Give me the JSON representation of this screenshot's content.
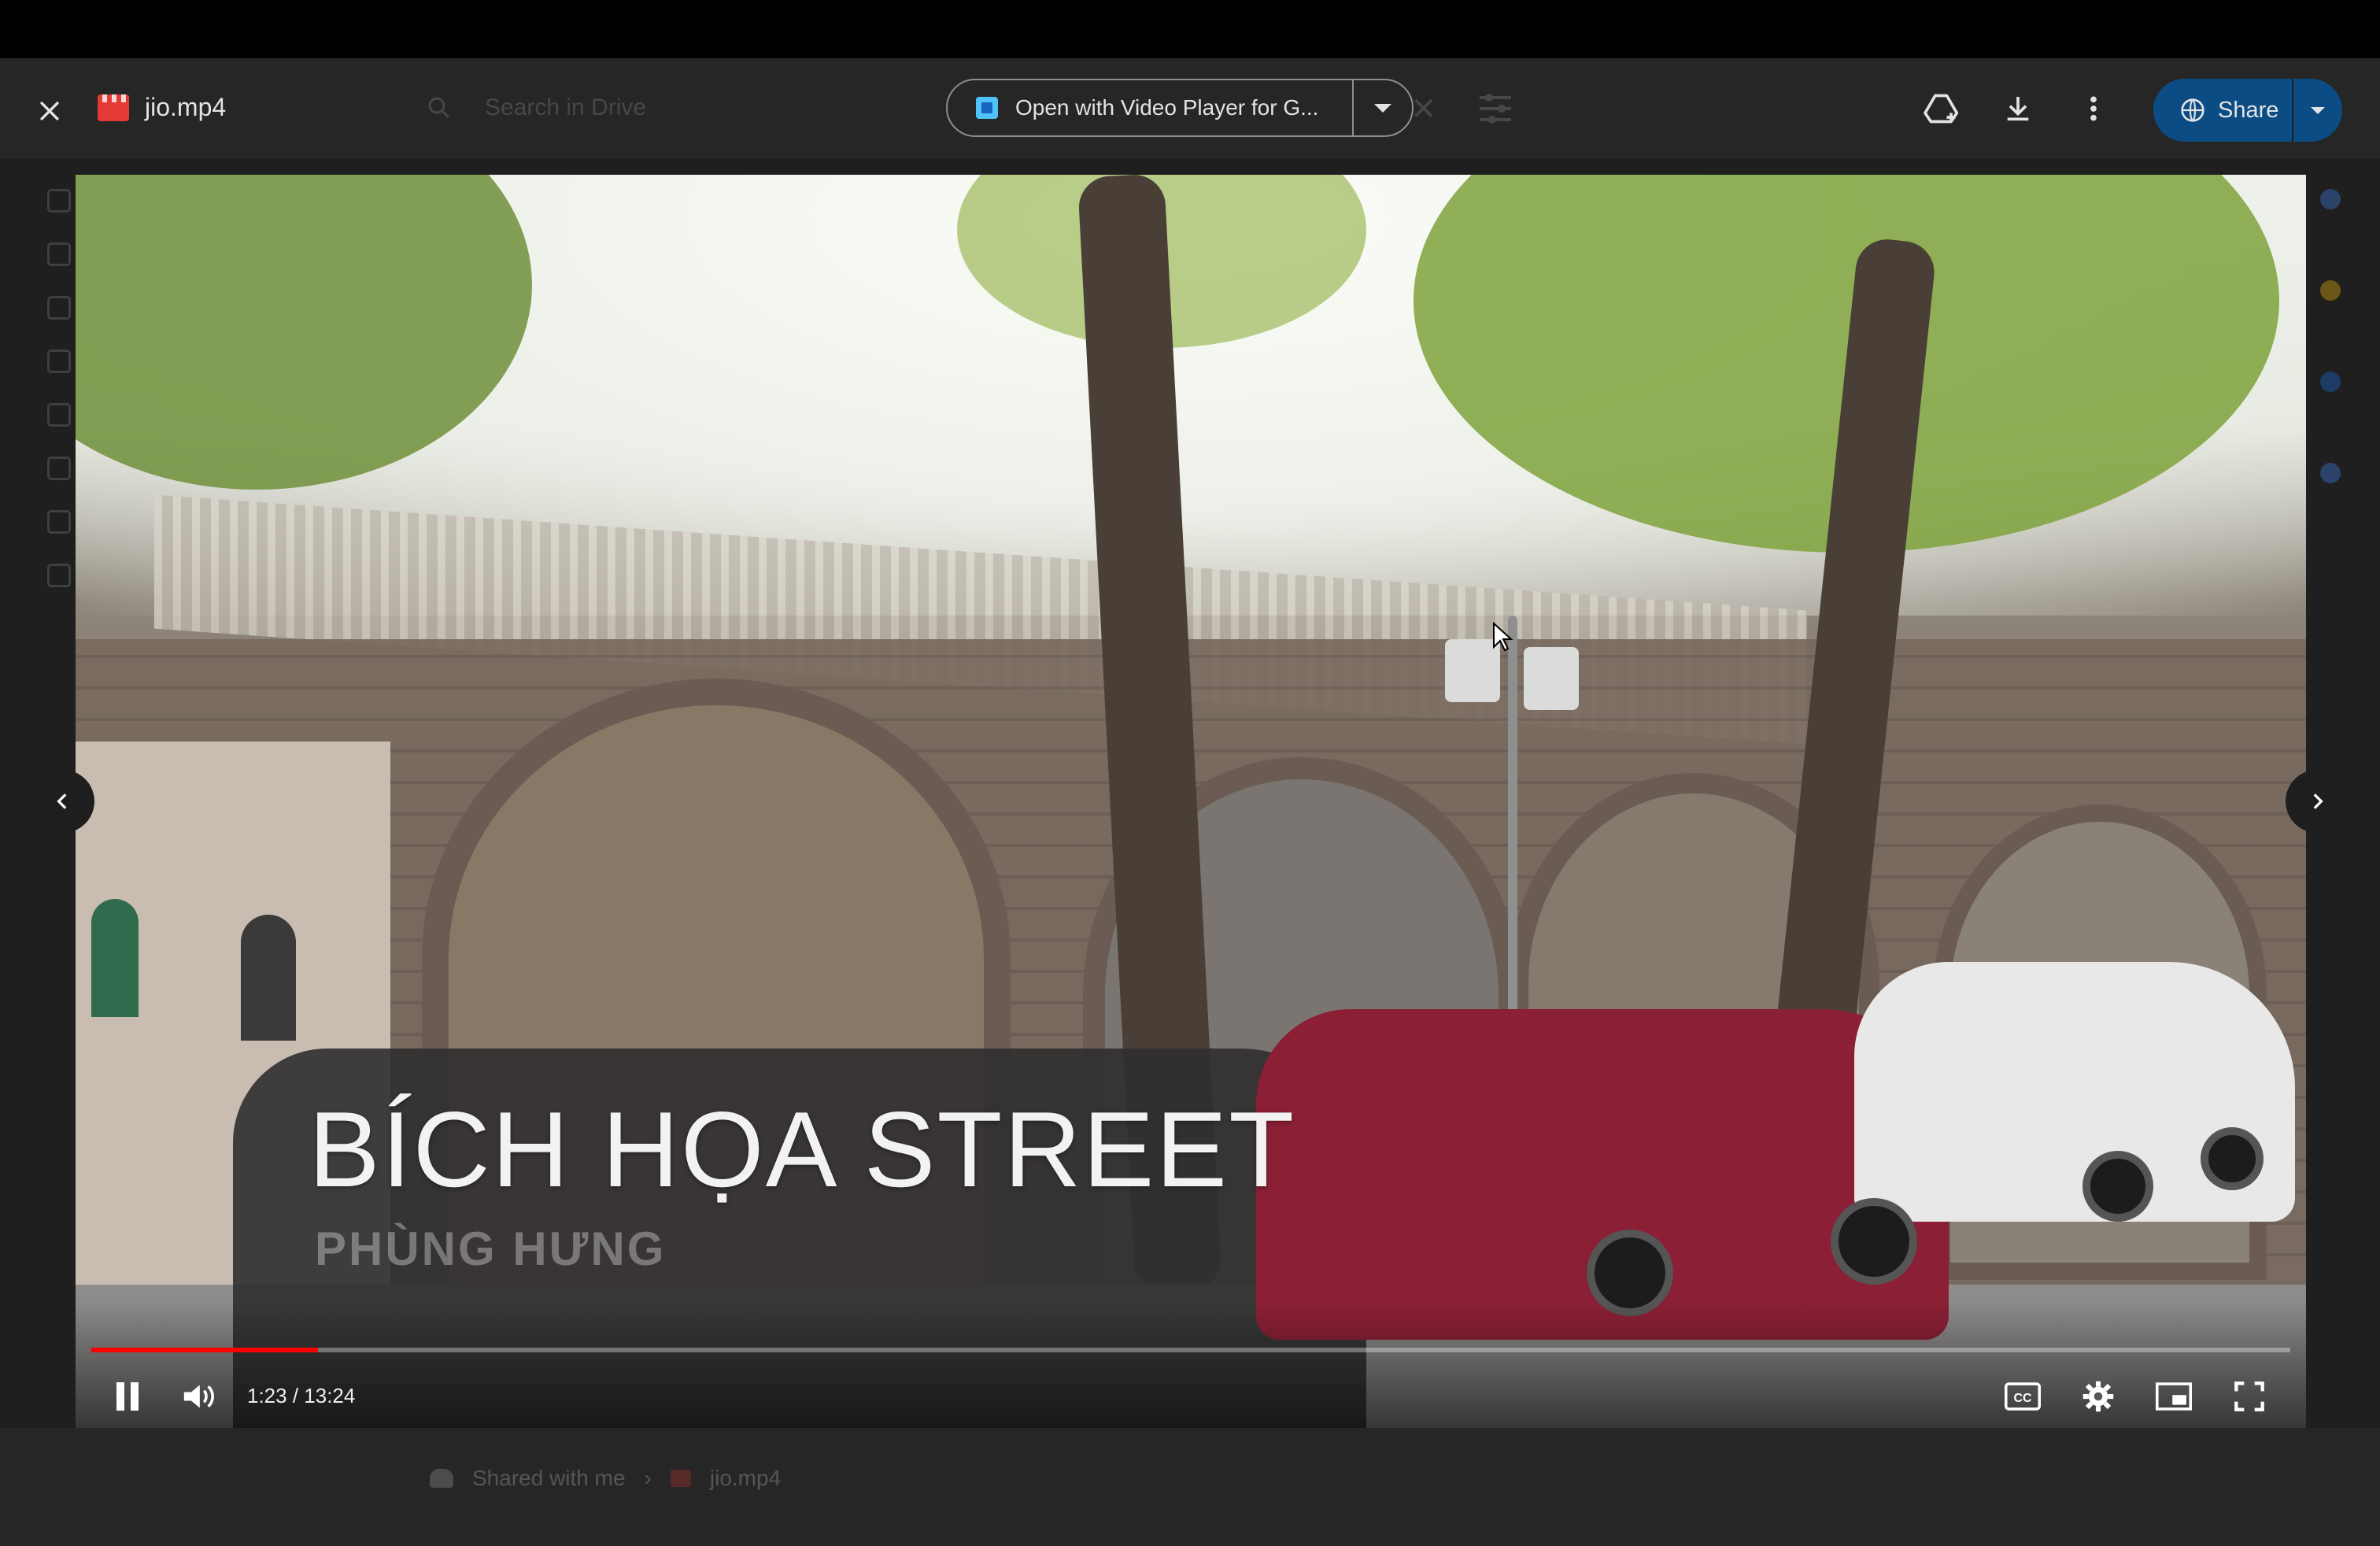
{
  "viewer": {
    "file_name": "jio.mp4",
    "open_with_label": "Open with Video Player for G...",
    "share_label": "Share"
  },
  "background_page": {
    "search_placeholder": "Search in Drive",
    "breadcrumb": [
      "Shared with me",
      "jio.mp4"
    ]
  },
  "video": {
    "title_overlay": "BÍCH HỌA STREET",
    "subtitle_overlay": "PHÙNG HƯNG",
    "current_time": "1:23",
    "duration": "13:24",
    "time_display": "1:23 / 13:24",
    "progress_fraction": 0.103,
    "state": "playing"
  },
  "icons": {
    "close": "close-icon",
    "file": "video-file-icon",
    "open_with": "video-player-app-icon",
    "add_to_drive": "add-to-drive-icon",
    "download": "download-icon",
    "more": "more-vert-icon",
    "share": "globe-icon",
    "pause": "pause-icon",
    "volume": "volume-icon",
    "captions": "cc-icon",
    "settings": "gear-icon",
    "miniplayer": "miniplayer-icon",
    "fullscreen": "fullscreen-icon",
    "prev": "chevron-left-icon",
    "next": "chevron-right-icon"
  },
  "colors": {
    "header_bg": "#262626",
    "share_bg": "#0b4c85",
    "progress": "#ff0000",
    "top_strip": "#000000"
  }
}
